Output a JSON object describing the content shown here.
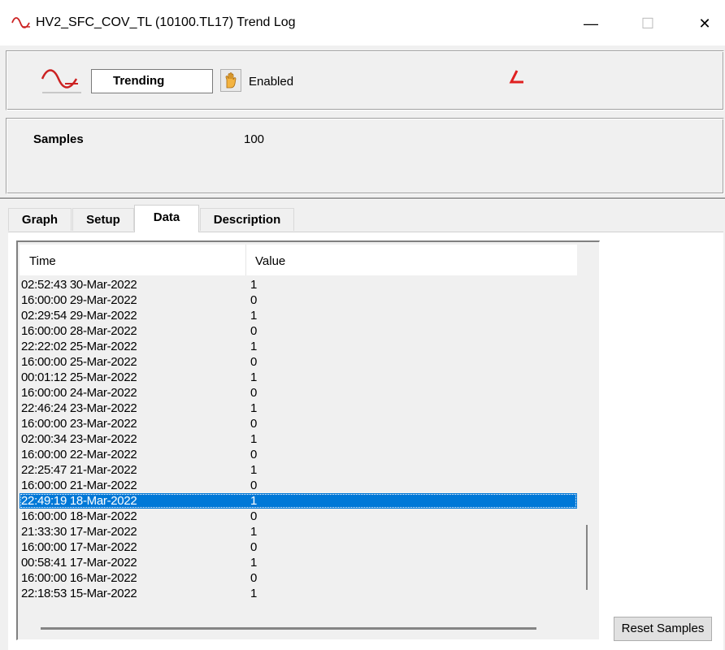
{
  "window": {
    "title": "HV2_SFC_COV_TL  (10100.TL17)  Trend Log",
    "minimize_glyph": "—",
    "maximize_glyph": "☐",
    "close_glyph": "✕",
    "icon": "trend-wave-icon"
  },
  "status": {
    "mode": "Trending",
    "enabled_label": "Enabled",
    "hand_icon": "hand-icon",
    "mode_icon": "trend-wave-icon"
  },
  "samples": {
    "label": "Samples",
    "value": "100"
  },
  "tabs": [
    {
      "label": "Graph",
      "active": false
    },
    {
      "label": "Setup",
      "active": false
    },
    {
      "label": "Data",
      "active": true
    },
    {
      "label": "Description",
      "active": false
    }
  ],
  "table": {
    "columns": [
      "Time",
      "Value"
    ],
    "rows": [
      {
        "time": "02:52:43 30-Mar-2022",
        "value": "1"
      },
      {
        "time": "16:00:00 29-Mar-2022",
        "value": "0"
      },
      {
        "time": "02:29:54 29-Mar-2022",
        "value": "1"
      },
      {
        "time": "16:00:00 28-Mar-2022",
        "value": "0"
      },
      {
        "time": "22:22:02 25-Mar-2022",
        "value": "1"
      },
      {
        "time": "16:00:00 25-Mar-2022",
        "value": "0"
      },
      {
        "time": "00:01:12 25-Mar-2022",
        "value": "1"
      },
      {
        "time": "16:00:00 24-Mar-2022",
        "value": "0"
      },
      {
        "time": "22:46:24 23-Mar-2022",
        "value": "1"
      },
      {
        "time": "16:00:00 23-Mar-2022",
        "value": "0"
      },
      {
        "time": "02:00:34 23-Mar-2022",
        "value": "1"
      },
      {
        "time": "16:00:00 22-Mar-2022",
        "value": "0"
      },
      {
        "time": "22:25:47 21-Mar-2022",
        "value": "1"
      },
      {
        "time": "16:00:00 21-Mar-2022",
        "value": "0"
      },
      {
        "time": "22:49:19 18-Mar-2022",
        "value": "1",
        "selected": true
      },
      {
        "time": "16:00:00 18-Mar-2022",
        "value": "0"
      },
      {
        "time": "21:33:30 17-Mar-2022",
        "value": "1"
      },
      {
        "time": "16:00:00 17-Mar-2022",
        "value": "0"
      },
      {
        "time": "00:58:41 17-Mar-2022",
        "value": "1"
      },
      {
        "time": "16:00:00 16-Mar-2022",
        "value": "0"
      },
      {
        "time": "22:18:53 15-Mar-2022",
        "value": "1"
      }
    ]
  },
  "buttons": {
    "reset_samples": "Reset Samples"
  },
  "colors": {
    "selection": "#0078d7",
    "background": "#f0f0f0",
    "trend_icon": "#cc2222"
  }
}
